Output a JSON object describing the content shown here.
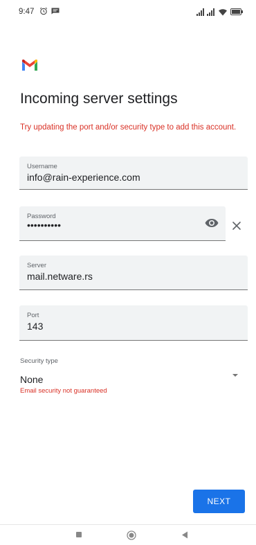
{
  "status_bar": {
    "time": "9:47",
    "icons": [
      "alarm-icon",
      "message-icon",
      "signal-icon",
      "signal-icon",
      "wifi-icon",
      "battery-icon"
    ]
  },
  "app": {
    "logo": "gmail-logo",
    "title": "Incoming server settings",
    "error": "Try updating the port and/or security type to add this account."
  },
  "fields": {
    "username": {
      "label": "Username",
      "value": "info@rain-experience.com"
    },
    "password": {
      "label": "Password",
      "value": "••••••••••"
    },
    "server": {
      "label": "Server",
      "value": "mail.netware.rs"
    },
    "port": {
      "label": "Port",
      "value": "143"
    }
  },
  "security": {
    "label": "Security type",
    "value": "None",
    "warning": "Email security not guaranteed"
  },
  "next_label": "NEXT",
  "nav": {
    "icons": [
      "recents-icon",
      "home-icon",
      "back-icon"
    ]
  },
  "colors": {
    "error": "#d93025",
    "accent": "#1a73e8",
    "field_bg": "#f1f3f4"
  }
}
